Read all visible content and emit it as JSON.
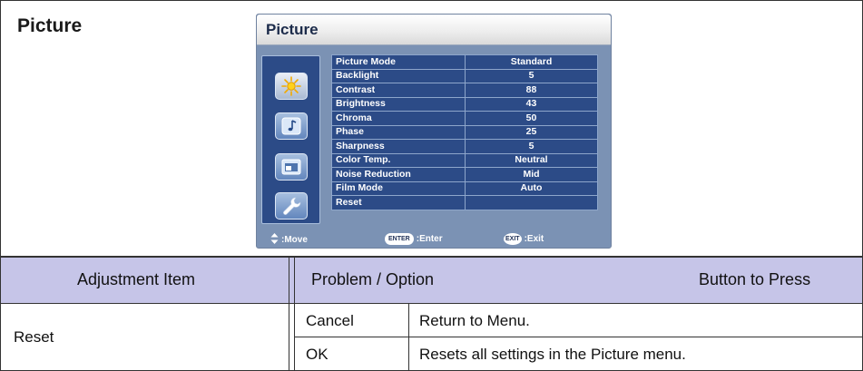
{
  "section_title": "Picture",
  "osd": {
    "title": "Picture",
    "menu_icons": [
      "sun-icon",
      "music-note-icon",
      "window-icon",
      "wrench-icon"
    ],
    "settings": [
      {
        "label": "Picture Mode",
        "value": "Standard"
      },
      {
        "label": "Backlight",
        "value": "5"
      },
      {
        "label": "Contrast",
        "value": "88"
      },
      {
        "label": "Brightness",
        "value": "43"
      },
      {
        "label": "Chroma",
        "value": "50"
      },
      {
        "label": "Phase",
        "value": "25"
      },
      {
        "label": "Sharpness",
        "value": "5"
      },
      {
        "label": "Color Temp.",
        "value": "Neutral"
      },
      {
        "label": "Noise Reduction",
        "value": "Mid"
      },
      {
        "label": "Film Mode",
        "value": "Auto"
      },
      {
        "label": "Reset",
        "value": ""
      }
    ],
    "footer": {
      "move_label": ":Move",
      "enter_key": "ENTER",
      "enter_label": ":Enter",
      "exit_key": "EXIT",
      "exit_label": ":Exit"
    }
  },
  "table": {
    "headers": {
      "item": "Adjustment Item",
      "option": "Problem / Option",
      "button": "Button to Press"
    },
    "item": "Reset",
    "rows": [
      {
        "option": "Cancel",
        "description": "Return to Menu."
      },
      {
        "option": "OK",
        "description": "Resets all settings in the Picture menu."
      }
    ]
  },
  "colors": {
    "header_band": "#c6c5e8",
    "osd_panel": "#2c4b87",
    "osd_frame": "#7b92b4"
  }
}
